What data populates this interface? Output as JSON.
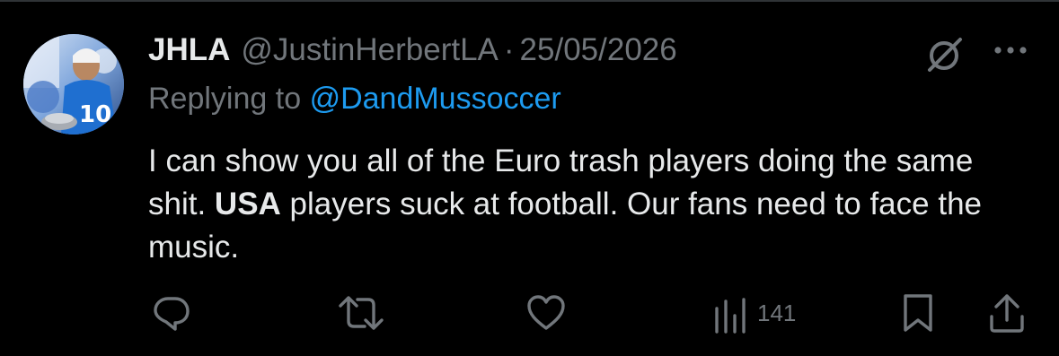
{
  "tweet": {
    "display_name": "JHLA",
    "handle": "@JustinHerbertLA",
    "separator": "·",
    "date": "25/05/2026",
    "reply_prefix": "Replying to",
    "reply_to": "@DandMussoccer",
    "text_part1": "I can show you all of the Euro trash players doing the same shit. ",
    "text_bold": "USA",
    "text_part2": " players suck at football. Our fans need to face the music."
  },
  "actions": {
    "reply_icon": "reply-icon",
    "retweet_icon": "retweet-icon",
    "like_icon": "heart-icon",
    "views_icon": "views-bar-chart-icon",
    "views_count": "141",
    "bookmark_icon": "bookmark-icon",
    "share_icon": "share-icon"
  },
  "header_icons": {
    "grok": "grok-icon",
    "more": "more-options-icon"
  },
  "colors": {
    "background": "#000000",
    "text_primary": "#e7e9ea",
    "text_secondary": "#71767b",
    "link": "#1d9bf0",
    "divider": "#2f3336"
  }
}
